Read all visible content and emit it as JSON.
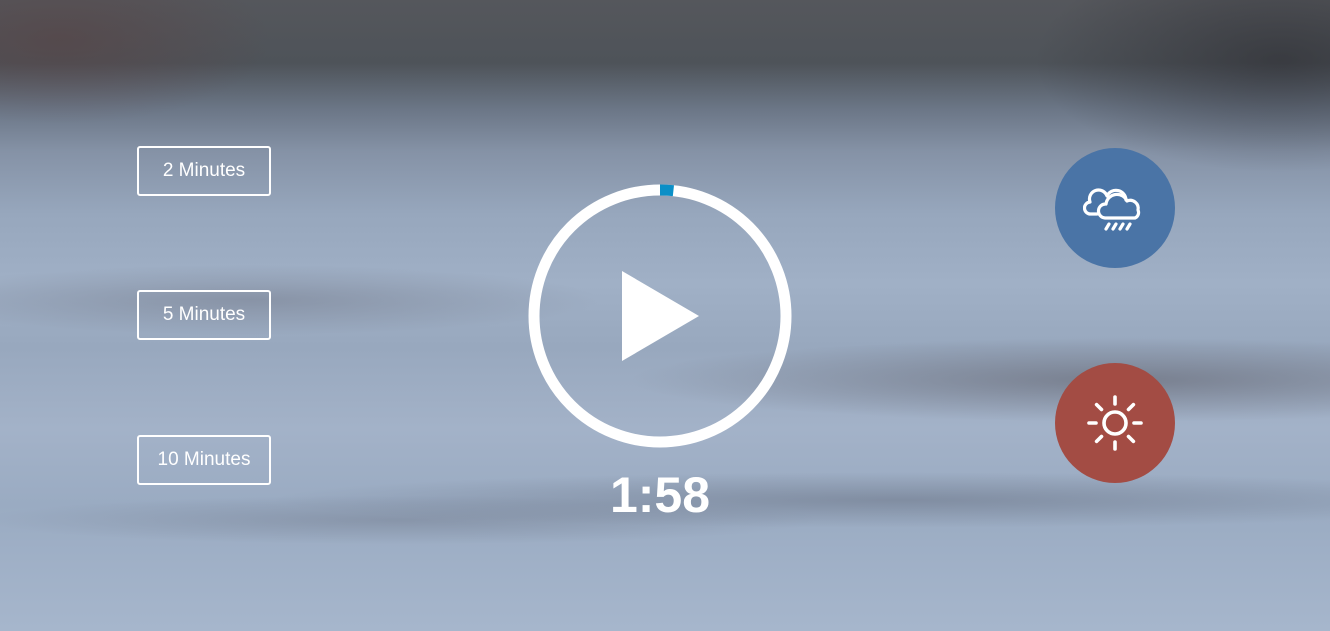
{
  "durations": {
    "two": "2 Minutes",
    "five": "5 Minutes",
    "ten": "10 Minutes"
  },
  "timer": {
    "remaining": "1:58",
    "progress": 0.017,
    "progress_color": "#0b8fc7",
    "ring_color": "#ffffff"
  },
  "sounds": {
    "rain": {
      "icon": "cloud-rain-icon",
      "color": "#4a74a6"
    },
    "sun": {
      "icon": "sun-icon",
      "color": "#a34c44"
    }
  }
}
